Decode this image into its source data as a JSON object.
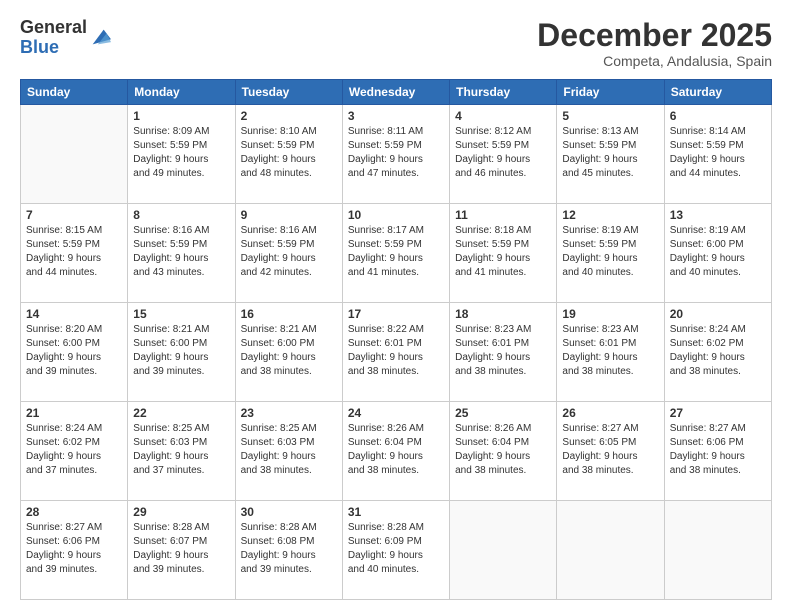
{
  "logo": {
    "general": "General",
    "blue": "Blue"
  },
  "header": {
    "month": "December 2025",
    "location": "Competa, Andalusia, Spain"
  },
  "weekdays": [
    "Sunday",
    "Monday",
    "Tuesday",
    "Wednesday",
    "Thursday",
    "Friday",
    "Saturday"
  ],
  "weeks": [
    [
      {
        "day": "",
        "info": ""
      },
      {
        "day": "1",
        "info": "Sunrise: 8:09 AM\nSunset: 5:59 PM\nDaylight: 9 hours\nand 49 minutes."
      },
      {
        "day": "2",
        "info": "Sunrise: 8:10 AM\nSunset: 5:59 PM\nDaylight: 9 hours\nand 48 minutes."
      },
      {
        "day": "3",
        "info": "Sunrise: 8:11 AM\nSunset: 5:59 PM\nDaylight: 9 hours\nand 47 minutes."
      },
      {
        "day": "4",
        "info": "Sunrise: 8:12 AM\nSunset: 5:59 PM\nDaylight: 9 hours\nand 46 minutes."
      },
      {
        "day": "5",
        "info": "Sunrise: 8:13 AM\nSunset: 5:59 PM\nDaylight: 9 hours\nand 45 minutes."
      },
      {
        "day": "6",
        "info": "Sunrise: 8:14 AM\nSunset: 5:59 PM\nDaylight: 9 hours\nand 44 minutes."
      }
    ],
    [
      {
        "day": "7",
        "info": "Sunrise: 8:15 AM\nSunset: 5:59 PM\nDaylight: 9 hours\nand 44 minutes."
      },
      {
        "day": "8",
        "info": "Sunrise: 8:16 AM\nSunset: 5:59 PM\nDaylight: 9 hours\nand 43 minutes."
      },
      {
        "day": "9",
        "info": "Sunrise: 8:16 AM\nSunset: 5:59 PM\nDaylight: 9 hours\nand 42 minutes."
      },
      {
        "day": "10",
        "info": "Sunrise: 8:17 AM\nSunset: 5:59 PM\nDaylight: 9 hours\nand 41 minutes."
      },
      {
        "day": "11",
        "info": "Sunrise: 8:18 AM\nSunset: 5:59 PM\nDaylight: 9 hours\nand 41 minutes."
      },
      {
        "day": "12",
        "info": "Sunrise: 8:19 AM\nSunset: 5:59 PM\nDaylight: 9 hours\nand 40 minutes."
      },
      {
        "day": "13",
        "info": "Sunrise: 8:19 AM\nSunset: 6:00 PM\nDaylight: 9 hours\nand 40 minutes."
      }
    ],
    [
      {
        "day": "14",
        "info": "Sunrise: 8:20 AM\nSunset: 6:00 PM\nDaylight: 9 hours\nand 39 minutes."
      },
      {
        "day": "15",
        "info": "Sunrise: 8:21 AM\nSunset: 6:00 PM\nDaylight: 9 hours\nand 39 minutes."
      },
      {
        "day": "16",
        "info": "Sunrise: 8:21 AM\nSunset: 6:00 PM\nDaylight: 9 hours\nand 38 minutes."
      },
      {
        "day": "17",
        "info": "Sunrise: 8:22 AM\nSunset: 6:01 PM\nDaylight: 9 hours\nand 38 minutes."
      },
      {
        "day": "18",
        "info": "Sunrise: 8:23 AM\nSunset: 6:01 PM\nDaylight: 9 hours\nand 38 minutes."
      },
      {
        "day": "19",
        "info": "Sunrise: 8:23 AM\nSunset: 6:01 PM\nDaylight: 9 hours\nand 38 minutes."
      },
      {
        "day": "20",
        "info": "Sunrise: 8:24 AM\nSunset: 6:02 PM\nDaylight: 9 hours\nand 38 minutes."
      }
    ],
    [
      {
        "day": "21",
        "info": "Sunrise: 8:24 AM\nSunset: 6:02 PM\nDaylight: 9 hours\nand 37 minutes."
      },
      {
        "day": "22",
        "info": "Sunrise: 8:25 AM\nSunset: 6:03 PM\nDaylight: 9 hours\nand 37 minutes."
      },
      {
        "day": "23",
        "info": "Sunrise: 8:25 AM\nSunset: 6:03 PM\nDaylight: 9 hours\nand 38 minutes."
      },
      {
        "day": "24",
        "info": "Sunrise: 8:26 AM\nSunset: 6:04 PM\nDaylight: 9 hours\nand 38 minutes."
      },
      {
        "day": "25",
        "info": "Sunrise: 8:26 AM\nSunset: 6:04 PM\nDaylight: 9 hours\nand 38 minutes."
      },
      {
        "day": "26",
        "info": "Sunrise: 8:27 AM\nSunset: 6:05 PM\nDaylight: 9 hours\nand 38 minutes."
      },
      {
        "day": "27",
        "info": "Sunrise: 8:27 AM\nSunset: 6:06 PM\nDaylight: 9 hours\nand 38 minutes."
      }
    ],
    [
      {
        "day": "28",
        "info": "Sunrise: 8:27 AM\nSunset: 6:06 PM\nDaylight: 9 hours\nand 39 minutes."
      },
      {
        "day": "29",
        "info": "Sunrise: 8:28 AM\nSunset: 6:07 PM\nDaylight: 9 hours\nand 39 minutes."
      },
      {
        "day": "30",
        "info": "Sunrise: 8:28 AM\nSunset: 6:08 PM\nDaylight: 9 hours\nand 39 minutes."
      },
      {
        "day": "31",
        "info": "Sunrise: 8:28 AM\nSunset: 6:09 PM\nDaylight: 9 hours\nand 40 minutes."
      },
      {
        "day": "",
        "info": ""
      },
      {
        "day": "",
        "info": ""
      },
      {
        "day": "",
        "info": ""
      }
    ]
  ]
}
